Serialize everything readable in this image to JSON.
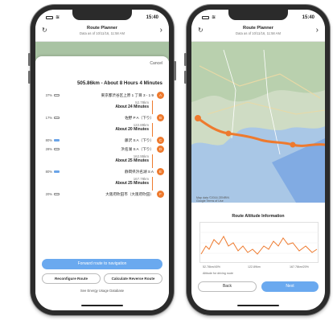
{
  "status_time": "15:40",
  "header": {
    "title": "Route Planner",
    "subtitle": "Data as of 10/11/16, 11:58 AM"
  },
  "planner": {
    "cancel_label": "Cancel",
    "summary": "505.86km - About 8 Hours 4 Minutes",
    "stops": [
      {
        "marker": "A",
        "name": "東京都渋谷区上原 1 丁目 3 - 1 9",
        "battery": "37%",
        "high": false
      },
      {
        "marker": "B",
        "name": "佐野 P A（下り）",
        "battery": "17%",
        "high": false
      },
      {
        "marker": "C",
        "name": "藤沢 S A（下り）",
        "battery": "80%",
        "high": true
      },
      {
        "marker": "D",
        "name": "浜名湖 S A（下り）",
        "battery": "28%",
        "high": false
      },
      {
        "marker": "E",
        "name": "静岡県浜名湖 S A",
        "battery": "80%",
        "high": true
      },
      {
        "marker": "F",
        "name": "大阪府吹田市（大阪府吹田）",
        "battery": "20%",
        "high": false
      }
    ],
    "legs": [
      {
        "time": "About 24 Minutes",
        "dist": "52.78km",
        "detail": "Details"
      },
      {
        "time": "About 20 Minutes",
        "dist": "122.89km",
        "detail": "Details"
      },
      {
        "time": "About 25 Minutes",
        "dist": "162.95km",
        "detail": "Details"
      },
      {
        "time": "About 25 Minutes",
        "dist": "167.78km",
        "detail": "Details"
      }
    ],
    "forward_label": "Forward route to navigation",
    "calc_reverse_label": "Calculate Reverse Route",
    "reconfigure_label": "Reconfigure Route",
    "energy_link": "See Energy Usage Database"
  },
  "detail": {
    "map_credit": "Map data ©2016 ZENRIN\nGoogle  Terms of Use",
    "altitude_title": "Route Altitude Information",
    "altitude_xlabels": [
      "52.78km/40%",
      "122.89km",
      "167.78km/20%"
    ],
    "altitude_legend": "Altitude for driving route",
    "back_label": "Back",
    "next_label": "Next"
  }
}
